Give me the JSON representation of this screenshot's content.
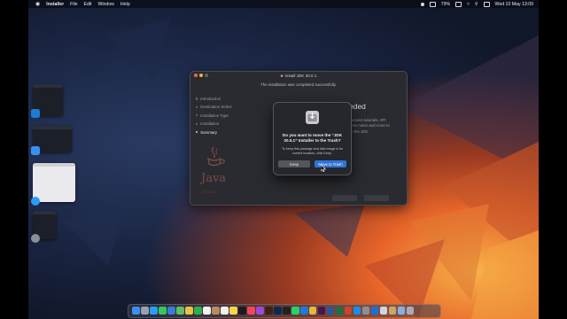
{
  "menubar": {
    "apple": "",
    "app": "Installer",
    "items": [
      "File",
      "Edit",
      "Window",
      "Help"
    ],
    "battery": "79%",
    "datetime": "Wed 10 May 13:09"
  },
  "installer": {
    "title": "Install JDK 20.0.1",
    "subtitle": "The installation was completed successfully.",
    "steps": [
      "Introduction",
      "Destination Select",
      "Installation Type",
      "Installation",
      "Summary"
    ],
    "active_step": "Summary",
    "heading_partial": "eded",
    "body_lines": [
      "access tutorials, API",
      "ese notes and more to",
      "n the JDK."
    ],
    "brand_java": "Java",
    "brand_oracle": "ORACLE",
    "icon": "java-coffee-cup-icon"
  },
  "dialog": {
    "icon": "installer-package-icon",
    "title": "Do you want to move the “JDK 20.0.1” Installer to the Trash?",
    "message": "To keep this package and disk image in its current location, click Keep.",
    "keep_label": "Keep",
    "trash_label": "Move to Trash",
    "accent": "#2f73d9"
  }
}
